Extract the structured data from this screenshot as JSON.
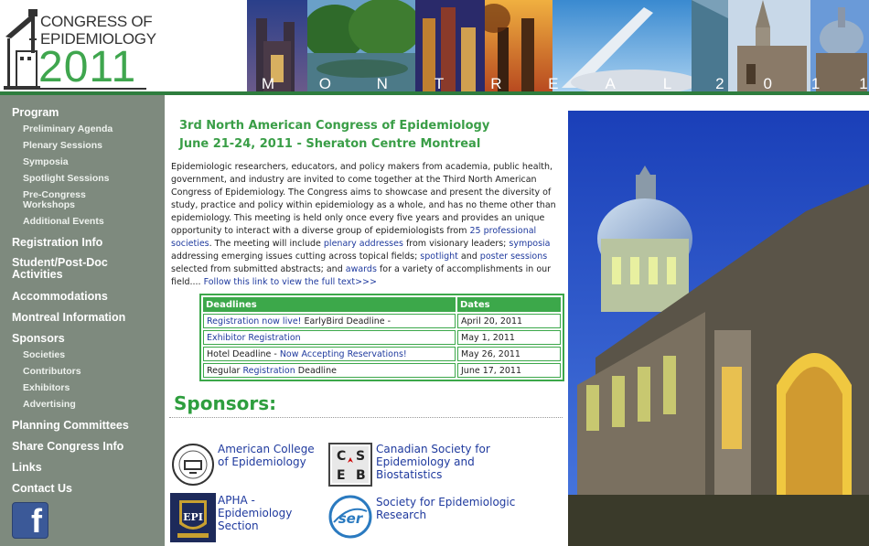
{
  "header": {
    "logo": {
      "line1": "CONGRESS OF",
      "line2": "EPIDEMIOLOGY",
      "year": "2011"
    },
    "city_letters": [
      "M",
      "O",
      "N",
      "T",
      "R",
      "E",
      "A",
      "L",
      "2",
      "0",
      "1",
      "1"
    ]
  },
  "sidebar": {
    "items": [
      {
        "label": "Program",
        "level": "top"
      },
      {
        "label": "Preliminary Agenda",
        "level": "sub"
      },
      {
        "label": "Plenary Sessions",
        "level": "sub"
      },
      {
        "label": "Symposia",
        "level": "sub"
      },
      {
        "label": "Spotlight Sessions",
        "level": "sub"
      },
      {
        "label": "Pre-Congress Workshops",
        "level": "sub"
      },
      {
        "label": "Additional Events",
        "level": "sub"
      },
      {
        "label": "Registration Info",
        "level": "top"
      },
      {
        "label": "Student/Post-Doc Activities",
        "level": "top"
      },
      {
        "label": "Accommodations",
        "level": "top"
      },
      {
        "label": "Montreal Information",
        "level": "top"
      },
      {
        "label": "Sponsors",
        "level": "top"
      },
      {
        "label": "Societies",
        "level": "sub"
      },
      {
        "label": "Contributors",
        "level": "sub"
      },
      {
        "label": "Exhibitors",
        "level": "sub"
      },
      {
        "label": "Advertising",
        "level": "sub"
      },
      {
        "label": "Planning Committees",
        "level": "top"
      },
      {
        "label": "Share Congress Info",
        "level": "top"
      },
      {
        "label": "Links",
        "level": "top"
      },
      {
        "label": "Contact Us",
        "level": "top"
      }
    ],
    "pre_congress_line1": "Pre-Congress",
    "pre_congress_line2": "Workshops",
    "student_line1": "Student/Post-Doc",
    "student_line2": "Activities",
    "facebook_glyph": "f"
  },
  "main": {
    "title": "3rd North American Congress of Epidemiology",
    "dates": "June 21-24, 2011 - Sheraton Centre Montreal",
    "intro": {
      "t1": "Epidemiologic researchers, educators, and policy makers from academia, public health, government, and industry are invited to come together at the Third North American Congress of Epidemiology.  The Congress aims to showcase and present the diversity of study, practice and policy within epidemiology as a whole, and has no theme other than epidemiology.  This meeting is held only once every five years and provides an unique opportunity to interact with a diverse group of epidemiologists from ",
      "l1": "25 professional societies",
      "t2": ".  The meeting will include ",
      "l2": "plenary addresses",
      "t3": " from visionary leaders; ",
      "l3": "symposia",
      "t4": " addressing emerging issues cutting across topical fields; ",
      "l4": "spotlight",
      "t5": " and ",
      "l5": "poster sessions",
      "t6": " selected from submitted abstracts; and ",
      "l6": "awards",
      "t7": " for a variety of accomplishments in our field.... ",
      "l7": "Follow this link to view the full text>>>"
    },
    "deadlines": {
      "headers": [
        "Deadlines",
        "Dates"
      ],
      "rows": [
        {
          "link": "Registration now live!",
          "text": " EarlyBird Deadline -",
          "date": "April 20, 2011"
        },
        {
          "link": "Exhibitor Registration",
          "text": "",
          "date": "May 1, 2011"
        },
        {
          "pre": "Hotel Deadline - ",
          "link": "Now Accepting Reservations!",
          "date": "May 26, 2011"
        },
        {
          "pre": "Regular ",
          "link": "Registration",
          "text": " Deadline",
          "date": "June 17, 2011"
        }
      ]
    },
    "sponsors_heading": "Sponsors:",
    "sponsors": [
      {
        "name": "American College of Epidemiology",
        "line1": "American College",
        "line2": "of Epidemiology"
      },
      {
        "name": "Canadian Society for Epidemiology and Biostatistics",
        "line1": "Canadian Society for",
        "line2": "Epidemiology and",
        "line3": "Biostatistics",
        "logo_letters": [
          "C",
          "S",
          "E",
          "B"
        ]
      },
      {
        "name": "APHA - Epidemiology Section",
        "line1": "APHA -",
        "line2": "Epidemiology",
        "line3": "Section",
        "logo_text": "EPI"
      },
      {
        "name": "Society for Epidemiologic Research",
        "line1": "Society for Epidemiologic",
        "line2": "Research",
        "logo_text": "ser"
      }
    ]
  },
  "colors": {
    "brand_green": "#3a9e47",
    "sidebar_bg": "#7e8a7e",
    "link_blue": "#1f3a9e",
    "facebook_blue": "#3b5998"
  }
}
